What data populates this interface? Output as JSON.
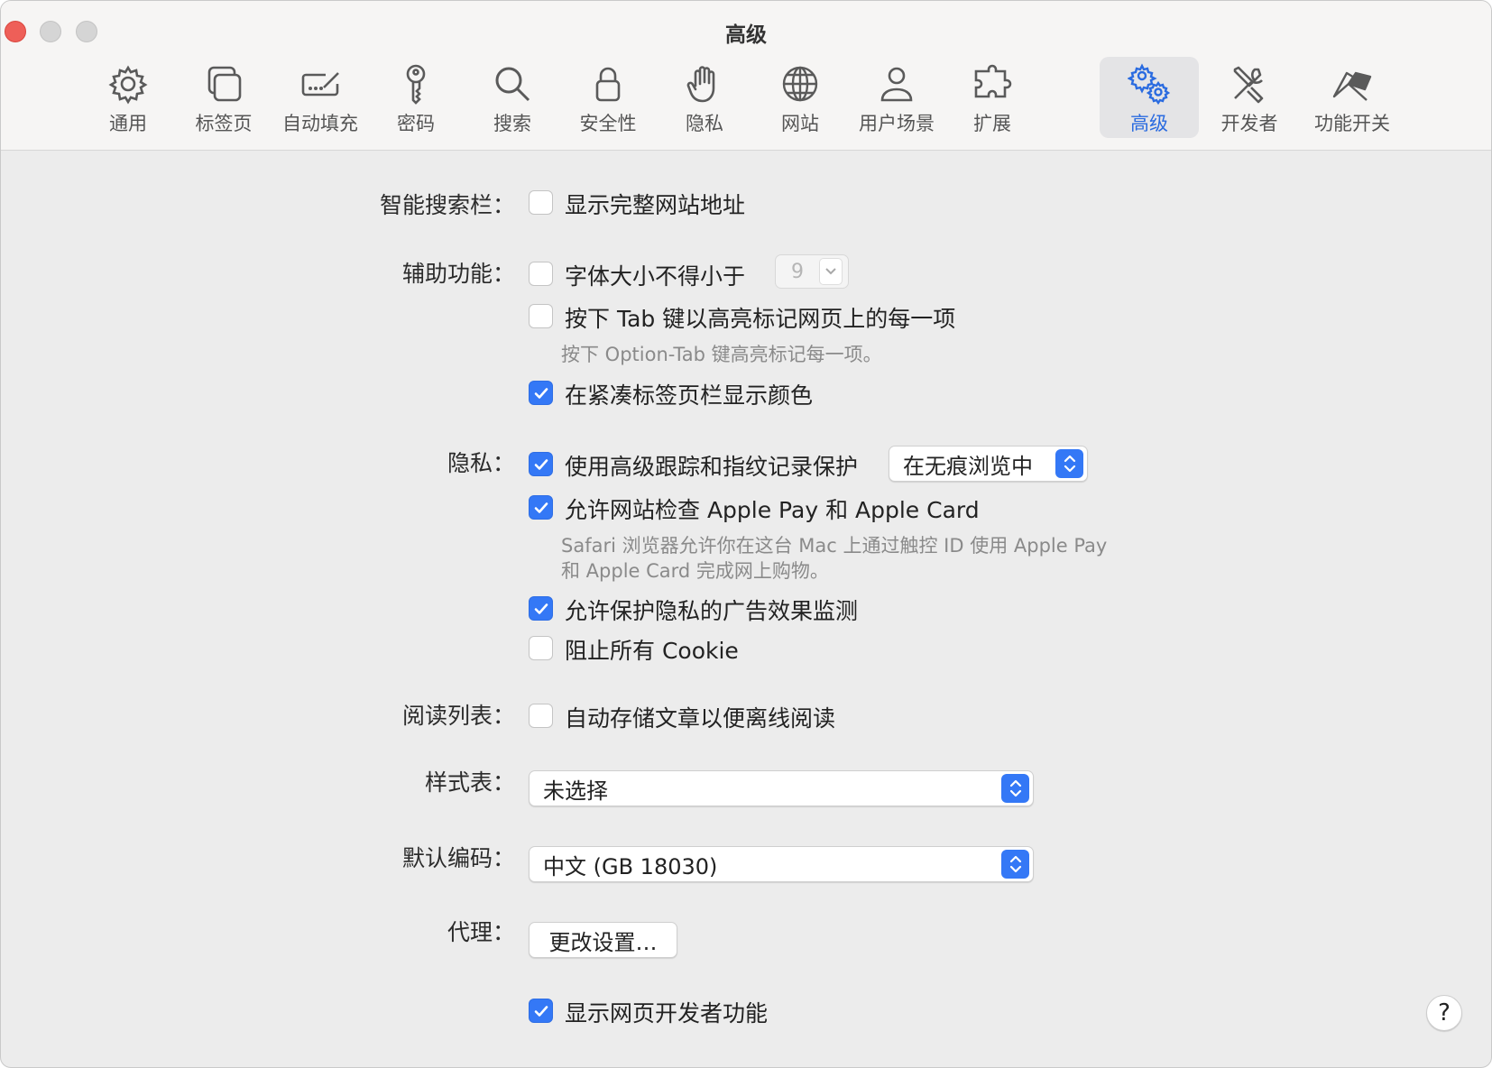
{
  "window": {
    "title": "高级"
  },
  "toolbar": {
    "items": [
      {
        "label": "通用",
        "icon": "gear-icon"
      },
      {
        "label": "标签页",
        "icon": "tabs-icon"
      },
      {
        "label": "自动填充",
        "icon": "autofill-icon"
      },
      {
        "label": "密码",
        "icon": "key-icon"
      },
      {
        "label": "搜索",
        "icon": "search-icon"
      },
      {
        "label": "安全性",
        "icon": "lock-icon"
      },
      {
        "label": "隐私",
        "icon": "hand-icon"
      },
      {
        "label": "网站",
        "icon": "globe-icon"
      },
      {
        "label": "用户场景",
        "icon": "person-icon"
      },
      {
        "label": "扩展",
        "icon": "puzzle-icon"
      },
      {
        "label": "高级",
        "icon": "gears-icon",
        "active": true
      },
      {
        "label": "开发者",
        "icon": "tools-icon"
      },
      {
        "label": "功能开关",
        "icon": "flags-icon"
      }
    ]
  },
  "smart_search": {
    "label": "智能搜索栏：",
    "show_full_address": {
      "label": "显示完整网站地址",
      "checked": false
    }
  },
  "accessibility": {
    "label": "辅助功能：",
    "min_font_size": {
      "label": "字体大小不得小于",
      "checked": false,
      "value": "9"
    },
    "tab_highlight": {
      "label": "按下 Tab 键以高亮标记网页上的每一项",
      "checked": false,
      "note": "按下 Option-Tab 键高亮标记每一项。"
    },
    "compact_tab_color": {
      "label": "在紧凑标签页栏显示颜色",
      "checked": true
    }
  },
  "privacy": {
    "label": "隐私：",
    "advanced_tracking": {
      "label": "使用高级跟踪和指纹记录保护",
      "checked": true,
      "mode": "在无痕浏览中"
    },
    "apple_pay": {
      "label": "允许网站检查 Apple Pay 和 Apple Card",
      "checked": true,
      "note_line1": "Safari 浏览器允许你在这台 Mac 上通过触控 ID 使用 Apple Pay",
      "note_line2": "和 Apple Card 完成网上购物。"
    },
    "ad_measurement": {
      "label": "允许保护隐私的广告效果监测",
      "checked": true
    },
    "block_cookies": {
      "label": "阻止所有 Cookie",
      "checked": false
    }
  },
  "reading_list": {
    "label": "阅读列表：",
    "save_offline": {
      "label": "自动存储文章以便离线阅读",
      "checked": false
    }
  },
  "stylesheet": {
    "label": "样式表：",
    "value": "未选择"
  },
  "encoding": {
    "label": "默认编码：",
    "value": "中文 (GB 18030)"
  },
  "proxies": {
    "label": "代理：",
    "button": "更改设置…"
  },
  "developer": {
    "show_features": {
      "label": "显示网页开发者功能",
      "checked": true
    }
  },
  "help": {
    "label": "?"
  },
  "colors": {
    "accent": "#3478f6",
    "close": "#ee5f58"
  }
}
